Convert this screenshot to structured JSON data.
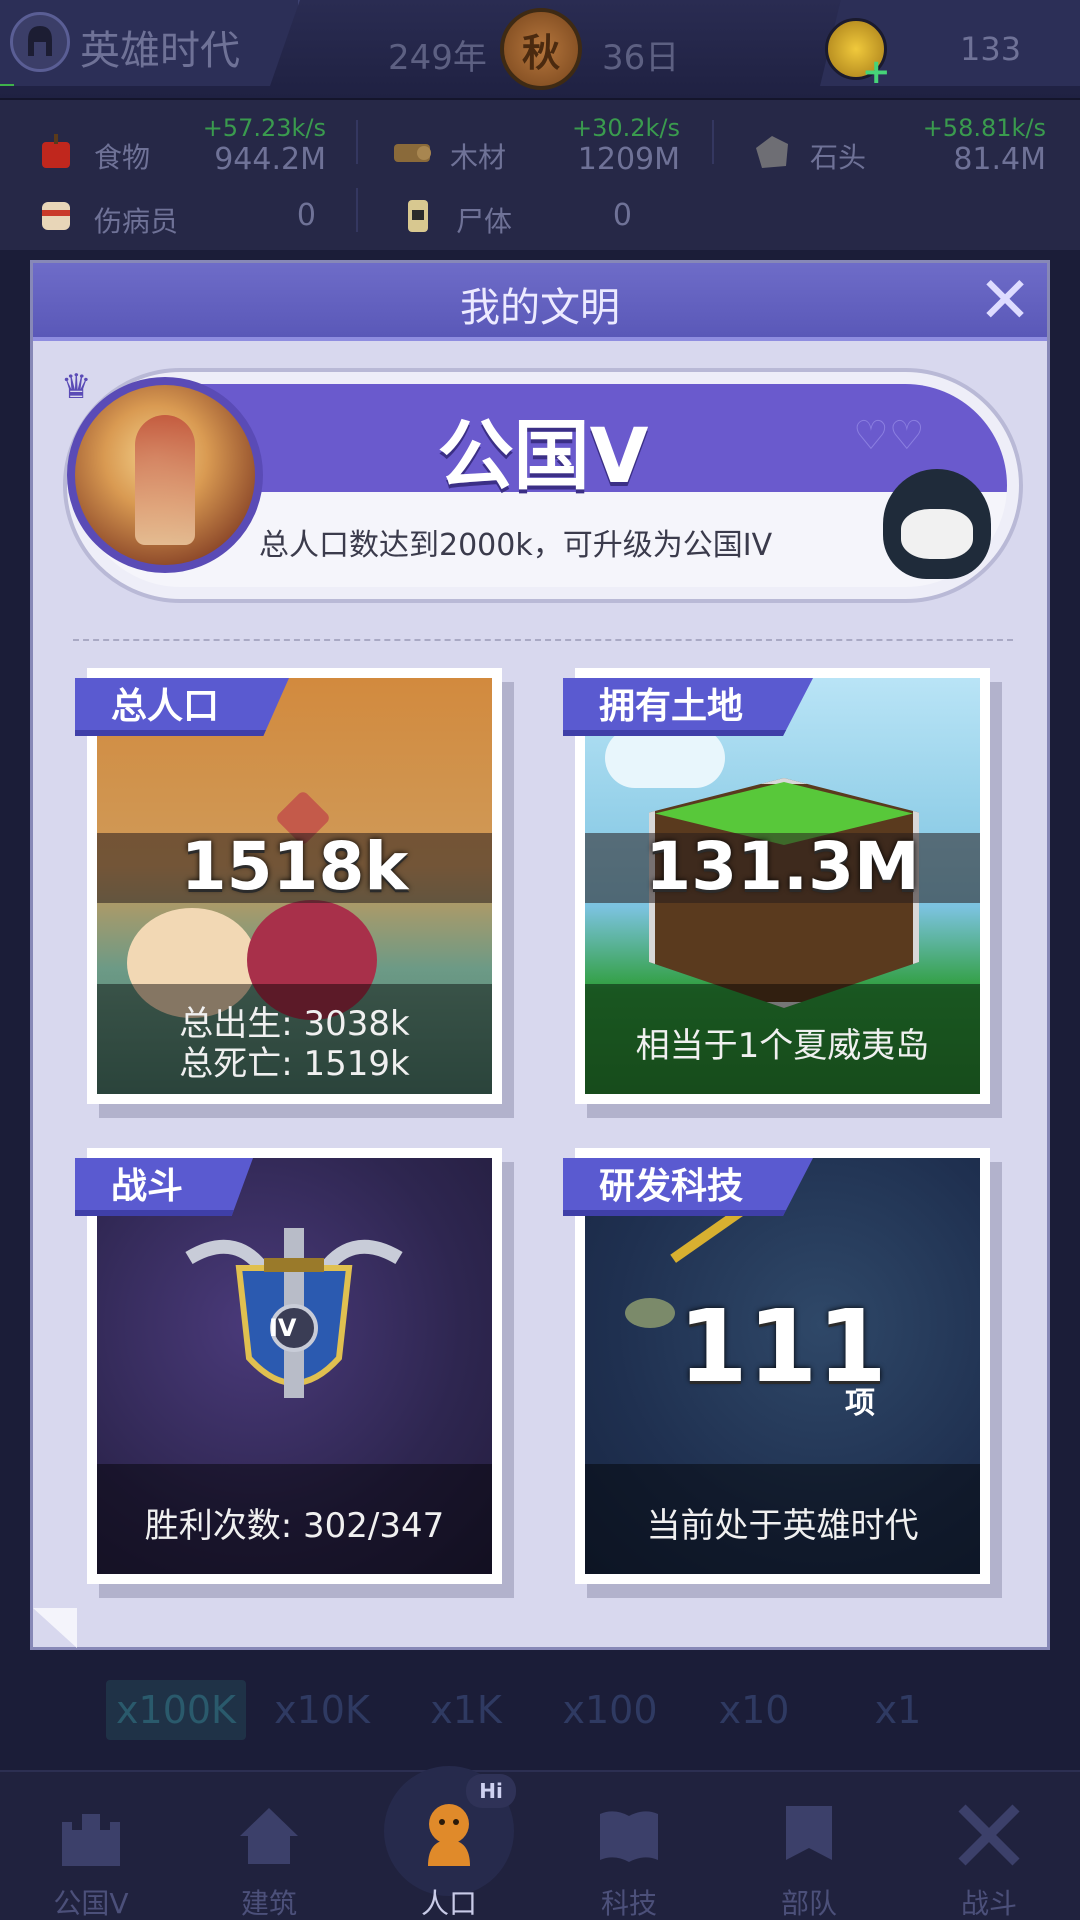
{
  "header": {
    "era_title": "英雄时代",
    "year": "249年",
    "season": "秋",
    "day": "36日",
    "coins": "133"
  },
  "resources": [
    {
      "label": "食物",
      "rate": "+57.23k/s",
      "value": "944.2M"
    },
    {
      "label": "木材",
      "rate": "+30.2k/s",
      "value": "1209M"
    },
    {
      "label": "石头",
      "rate": "+58.81k/s",
      "value": "81.4M"
    },
    {
      "label": "伤病员",
      "value": "0"
    },
    {
      "label": "尸体",
      "value": "0"
    }
  ],
  "dialog": {
    "title": "我的文明",
    "rank": {
      "name": "公国V",
      "description": "总人口数达到2000k，可升级为公国IV"
    },
    "cards": {
      "population": {
        "tab": "总人口",
        "value": "1518k",
        "births": "总出生: 3038k",
        "deaths": "总死亡: 1519k"
      },
      "land": {
        "tab": "拥有土地",
        "value": "131.3M",
        "note": "相当于1个夏威夷岛"
      },
      "battle": {
        "tab": "战斗",
        "badge": "IV",
        "note": "胜利次数: 302/347"
      },
      "tech": {
        "tab": "研发科技",
        "value": "111",
        "unit": "项",
        "note": "当前处于英雄时代"
      }
    }
  },
  "multipliers": [
    "x100K",
    "x10K",
    "x1K",
    "x100",
    "x10",
    "x1"
  ],
  "nav": [
    {
      "label": "公国V",
      "icon": "castle-icon"
    },
    {
      "label": "建筑",
      "icon": "house-icon"
    },
    {
      "label": "人口",
      "icon": "person-icon",
      "bubble": "Hi"
    },
    {
      "label": "科技",
      "icon": "book-icon"
    },
    {
      "label": "部队",
      "icon": "banner-icon"
    },
    {
      "label": "战斗",
      "icon": "crossed-swords-icon"
    }
  ],
  "colors": {
    "accent": "#5a5ad0",
    "rate_green": "#3a9b4e",
    "dialog_bg": "#d8d8ee"
  }
}
